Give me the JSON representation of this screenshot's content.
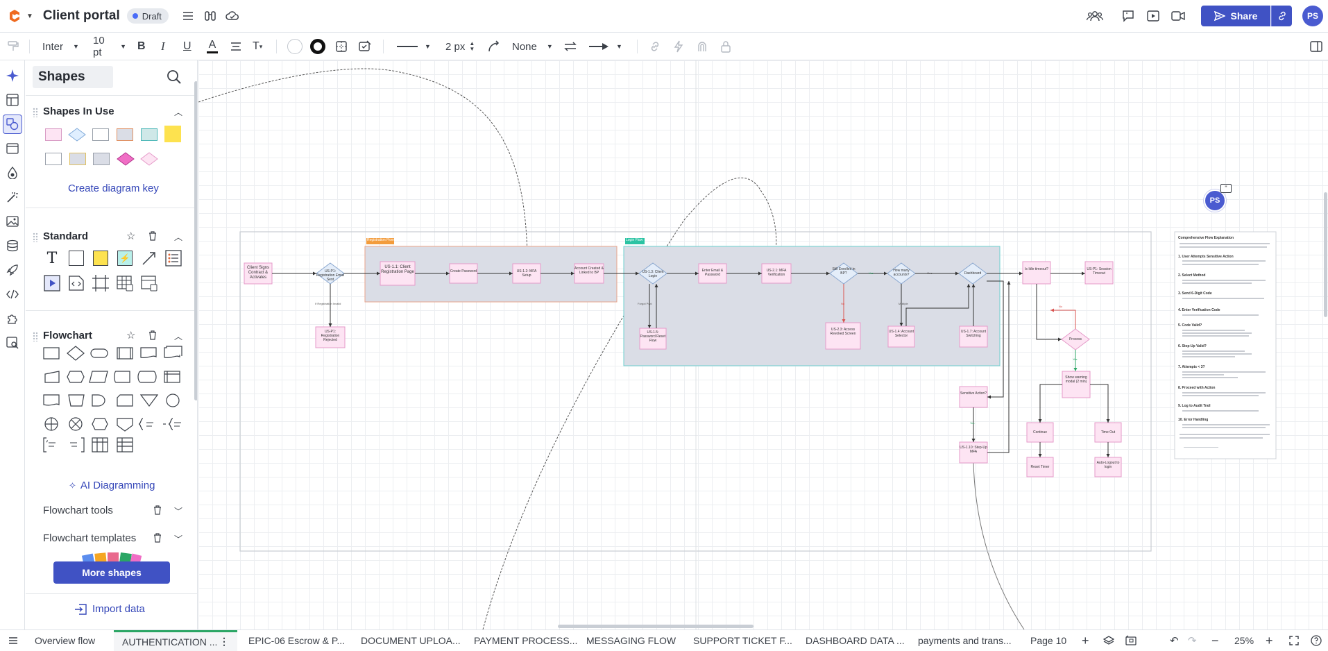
{
  "header": {
    "title": "Client portal",
    "status": "Draft",
    "share_label": "Share",
    "avatar_initials": "PS"
  },
  "format": {
    "font": "Inter",
    "font_size": "10 pt",
    "line_width": "2 px",
    "endpoint": "None"
  },
  "panel": {
    "title": "Shapes",
    "shapes_in_use": "Shapes In Use",
    "create_key": "Create diagram key",
    "standard": "Standard",
    "flowchart": "Flowchart",
    "ai": "AI Diagramming",
    "flowchart_tools": "Flowchart tools",
    "flowchart_templates": "Flowchart templates",
    "more_shapes": "More shapes",
    "import_data": "Import data"
  },
  "canvas": {
    "lane1": "Registration Flow",
    "lane2": "Login Flow",
    "collab_initials": "PS",
    "nodes": {
      "n1": "Client Signs Contract & Activates",
      "n2": "US-P1: Registration Email Sent",
      "n3": "US-P1: Registration Rejected",
      "n4": "US-1.1: Client Registration Page",
      "n5": "Create Password",
      "n6": "US-1.2: MFA Setup",
      "n7": "Account Created & Linked to BP",
      "n8": "US-1.3: Client Login",
      "n9": "US-1.5: Password Reset Flow",
      "n10": "Enter Email & Password",
      "n11": "US-2.1: MFA Verification",
      "n12": "Still Enrolled in BP?",
      "n13": "US-2.3: Access Revoked Screen",
      "n14": "How many accounts?",
      "n15": "US-1.4: Account Selector",
      "n16": "Dashboard",
      "n17": "US-1.7: Account Switching",
      "n18": "Is Idle timeout?",
      "n19": "US-P1: Session Timeout",
      "n20": "Process",
      "n21": "Show warning modal (2 min)",
      "n22": "Continue",
      "n23": "Time Out",
      "n24": "Reset Timer",
      "n25": "Auto-Logout to login",
      "n26": "Sensitive Action?",
      "n27": "US-1.10: Step-Up MFA"
    },
    "labels": {
      "reg_invalid": "If Registration Invalid",
      "forgot": "Forgot Pwd",
      "no": "No",
      "yes": "Yes",
      "many": "Multiple",
      "one": "One"
    },
    "doc": {
      "title": "Comprehensive Flow Explanation",
      "h1": "1. User Attempts Sensitive Action",
      "h2": "2. Select Method",
      "h3": "3. Send 6-Digit Code",
      "h4": "4. Enter Verification Code",
      "h5": "5. Code Valid?",
      "h6": "6. Step-Up Valid?",
      "h7": "7. Attempts < 3?",
      "h8": "8. Proceed with Action",
      "h9": "9. Log to Audit Trail",
      "h10": "10. Error Handling"
    }
  },
  "tabs": [
    "Overview flow",
    "AUTHENTICATION ...",
    "EPIC-06 Escrow & P...",
    "DOCUMENT UPLOA...",
    "PAYMENT PROCESS...",
    "MESSAGING FLOW",
    "SUPPORT TICKET F...",
    "DASHBOARD DATA ...",
    "payments and trans...",
    "Page 10"
  ],
  "zoom": "25%"
}
